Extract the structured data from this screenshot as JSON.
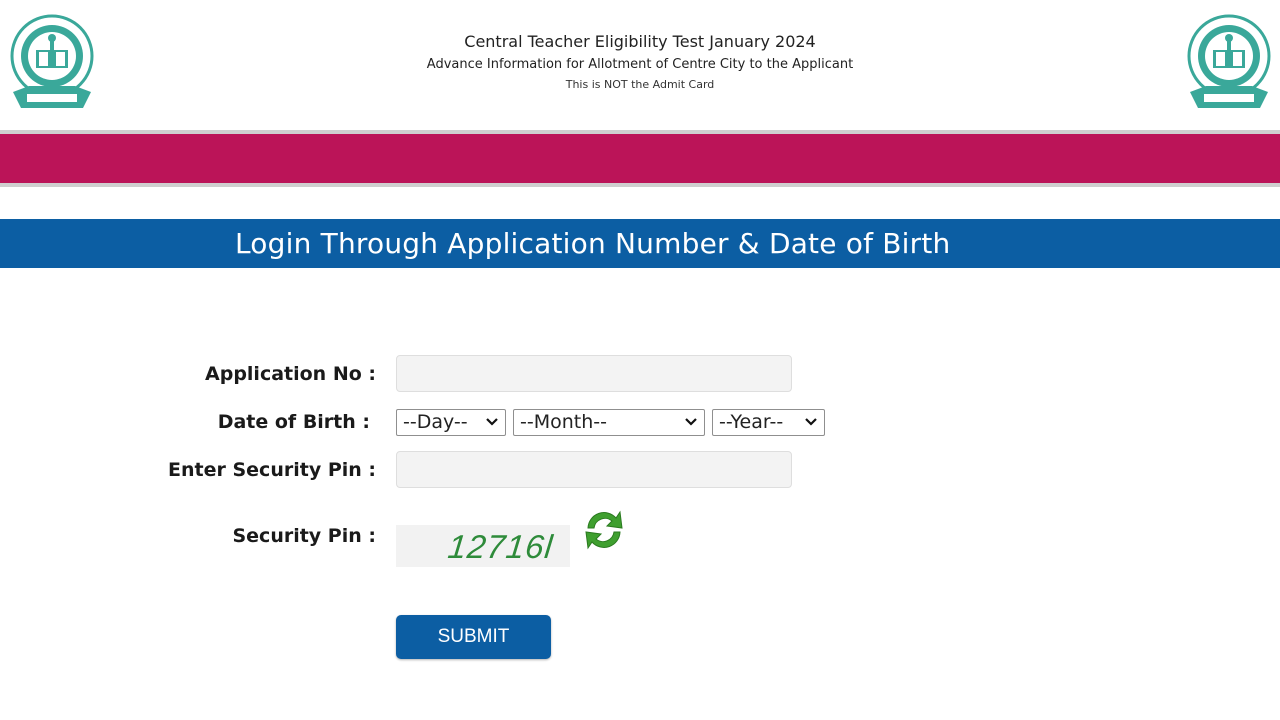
{
  "header": {
    "title": "Central Teacher Eligibility Test January 2024",
    "subtitle": "Advance Information for Allotment of Centre City to the Applicant",
    "note": "This is NOT the Admit Card",
    "logo_icon": "cbse-emblem-icon"
  },
  "colors": {
    "magenta_band": "#bb1458",
    "login_bar": "#0c5ea3",
    "submit_button": "#0c5ea3",
    "captcha_text": "#2e8b3a"
  },
  "login": {
    "title": "Login Through Application Number & Date of Birth"
  },
  "form": {
    "application_no": {
      "label": "Application No :",
      "value": "",
      "placeholder": ""
    },
    "dob": {
      "label": "Date of Birth :",
      "day": "--Day--",
      "month": "--Month--",
      "year": "--Year--"
    },
    "enter_security_pin": {
      "label": "Enter Security Pin :",
      "value": "",
      "placeholder": ""
    },
    "security_pin": {
      "label": "Security Pin :",
      "captcha": "12716l",
      "refresh_icon": "refresh-icon"
    },
    "submit_label": "SUBMIT"
  }
}
